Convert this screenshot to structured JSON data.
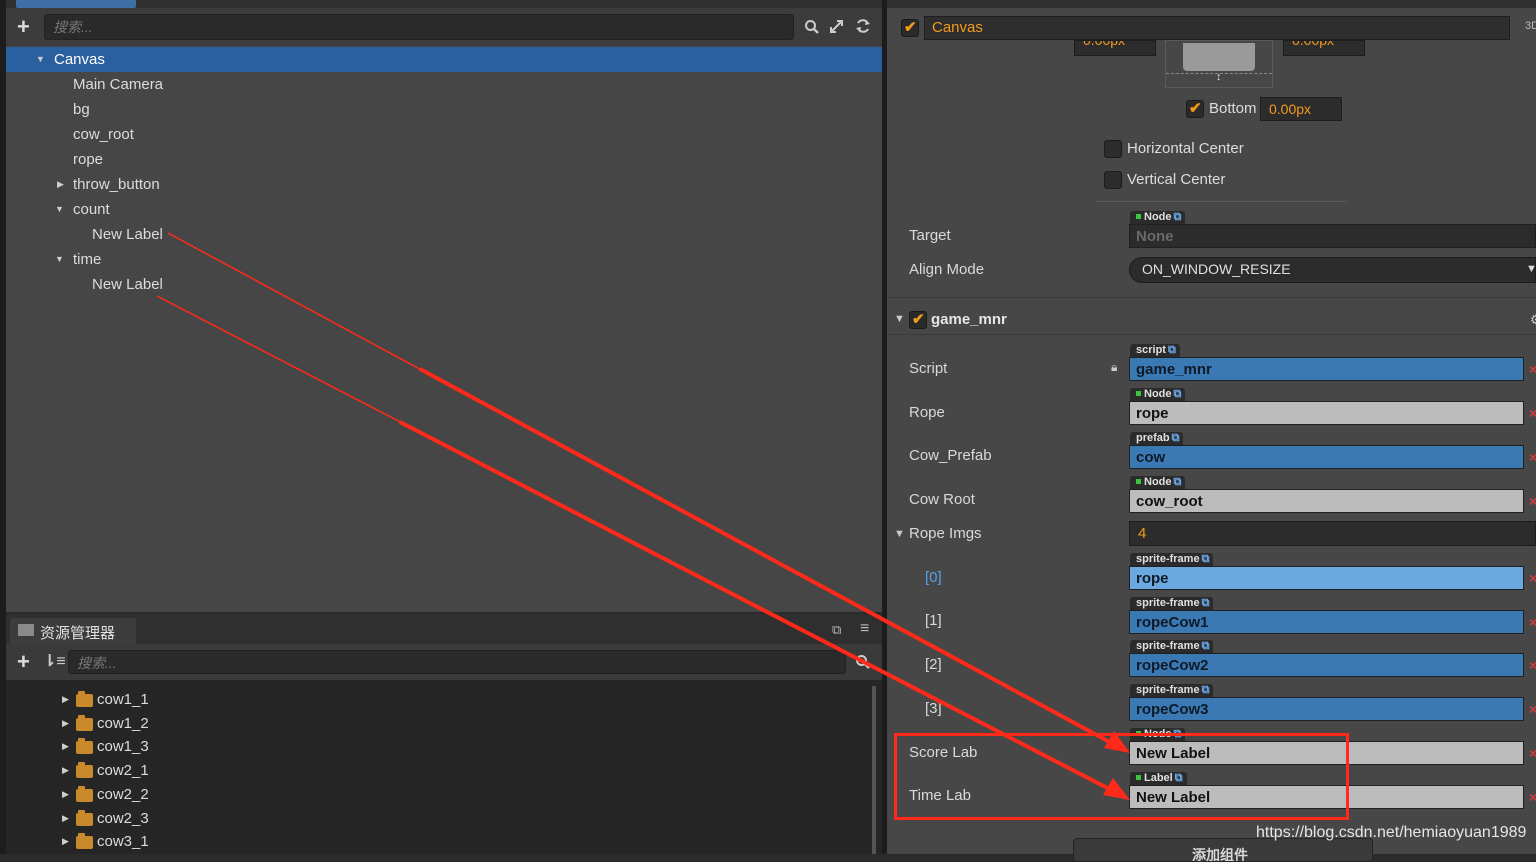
{
  "hierarchy": {
    "search_placeholder": "搜索...",
    "nodes": [
      {
        "label": "Canvas",
        "selected": true,
        "expander": "open",
        "indent": 0
      },
      {
        "label": "Main Camera",
        "indent": 1
      },
      {
        "label": "bg",
        "indent": 1
      },
      {
        "label": "cow_root",
        "indent": 1
      },
      {
        "label": "rope",
        "indent": 1
      },
      {
        "label": "throw_button",
        "indent": 1,
        "expander": "closed"
      },
      {
        "label": "count",
        "indent": 1,
        "expander": "open"
      },
      {
        "label": "New Label",
        "indent": 2
      },
      {
        "label": "time",
        "indent": 1,
        "expander": "open"
      },
      {
        "label": "New Label",
        "indent": 2
      }
    ]
  },
  "assets": {
    "title": "资源管理器",
    "search_placeholder": "搜索...",
    "items": [
      "cow1_1",
      "cow1_2",
      "cow1_3",
      "cow2_1",
      "cow2_2",
      "cow2_3",
      "cow3_1"
    ]
  },
  "inspector": {
    "node_name": "Canvas",
    "corner_label": "3D",
    "top_value_left": "0.00px",
    "top_value_right": "0.00px",
    "bottom_label": "Bottom",
    "bottom_value": "0.00px",
    "horizontal_center": "Horizontal Center",
    "vertical_center": "Vertical Center",
    "target_label": "Target",
    "target_tag": "Node",
    "target_value": "None",
    "align_mode_label": "Align Mode",
    "align_mode_value": "ON_WINDOW_RESIZE",
    "component_name": "game_mnr",
    "props": {
      "script": {
        "label": "Script",
        "tag": "script",
        "value": "game_mnr"
      },
      "rope": {
        "label": "Rope",
        "tag": "Node",
        "value": "rope"
      },
      "cow_prefab": {
        "label": "Cow_Prefab",
        "tag": "prefab",
        "value": "cow"
      },
      "cow_root": {
        "label": "Cow Root",
        "tag": "Node",
        "value": "cow_root"
      },
      "rope_imgs": {
        "label": "Rope Imgs",
        "value": "4"
      },
      "img0": {
        "label": "[0]",
        "tag": "sprite-frame",
        "value": "rope"
      },
      "img1": {
        "label": "[1]",
        "tag": "sprite-frame",
        "value": "ropeCow1"
      },
      "img2": {
        "label": "[2]",
        "tag": "sprite-frame",
        "value": "ropeCow2"
      },
      "img3": {
        "label": "[3]",
        "tag": "sprite-frame",
        "value": "ropeCow3"
      },
      "score_lab": {
        "label": "Score Lab",
        "tag": "Node",
        "value": "New Label"
      },
      "time_lab": {
        "label": "Time Lab",
        "tag": "Label",
        "value": "New Label"
      }
    },
    "add_component": "添加组件"
  },
  "watermark": "https://blog.csdn.net/hemiaoyuan1989",
  "colors": {
    "selection": "#2a5fa0",
    "accent_orange": "#f39a1e",
    "annotation_red": "#ff2a1a",
    "asset_field": "#3b79b5",
    "node_field": "#bcbcbc"
  }
}
